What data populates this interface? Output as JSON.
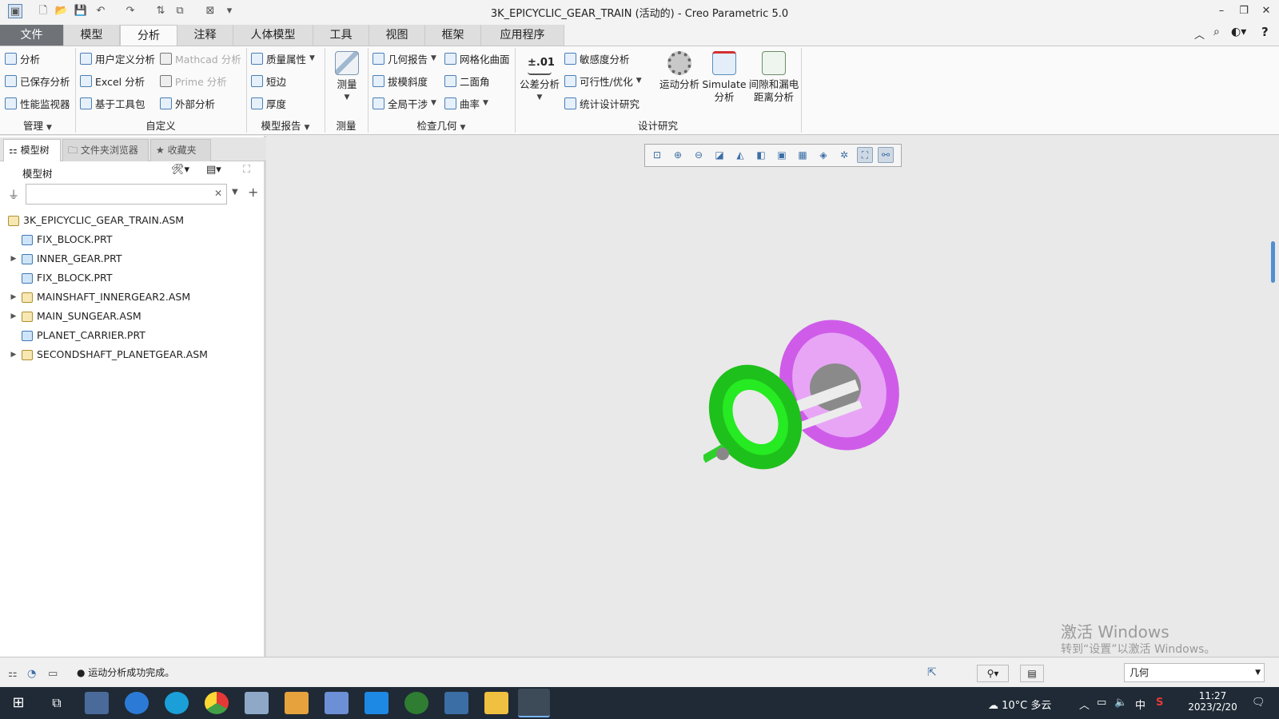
{
  "title": "3K_EPICYCLIC_GEAR_TRAIN (活动的) - Creo Parametric 5.0",
  "tabs": [
    "文件",
    "模型",
    "分析",
    "注释",
    "人体模型",
    "工具",
    "视图",
    "框架",
    "应用程序"
  ],
  "ribbon": {
    "manage": {
      "items": [
        "分析",
        "已保存分析",
        "性能监视器"
      ],
      "group": "管理"
    },
    "custom": {
      "items": [
        "用户定义分析",
        "Excel 分析",
        "基于工具包",
        "Mathcad 分析",
        "Prime 分析",
        "外部分析"
      ],
      "group": "自定义"
    },
    "model_report": {
      "items": [
        "质量属性",
        "短边",
        "厚度"
      ],
      "group": "模型报告"
    },
    "measure": {
      "label": "测量",
      "group": "测量"
    },
    "inspect": {
      "items": [
        "几何报告",
        "拔模斜度",
        "全局干涉",
        "网格化曲面",
        "二面角",
        "曲率"
      ],
      "group": "检查几何"
    },
    "design": {
      "tolerance": "公差分析",
      "tolerance_icon": "±.01",
      "items": [
        "敏感度分析",
        "可行性/优化",
        "统计设计研究"
      ],
      "motion": "运动分析",
      "simulate": [
        "Simulate",
        "分析"
      ],
      "clearance": [
        "间隙和漏电",
        "距离分析"
      ],
      "group": "设计研究"
    }
  },
  "panel": {
    "tabs": [
      "模型树",
      "文件夹浏览器",
      "收藏夹"
    ],
    "header": "模型树",
    "tree": [
      {
        "name": "3K_EPICYCLIC_GEAR_TRAIN.ASM",
        "level": 0,
        "expand": false,
        "type": "asm"
      },
      {
        "name": "FIX_BLOCK.PRT",
        "level": 1,
        "expand": false,
        "type": "prt"
      },
      {
        "name": "INNER_GEAR.PRT",
        "level": 1,
        "expand": true,
        "type": "prt"
      },
      {
        "name": "FIX_BLOCK.PRT",
        "level": 1,
        "expand": false,
        "type": "prt"
      },
      {
        "name": "MAINSHAFT_INNERGEAR2.ASM",
        "level": 1,
        "expand": true,
        "type": "asm"
      },
      {
        "name": "MAIN_SUNGEAR.ASM",
        "level": 1,
        "expand": true,
        "type": "asm"
      },
      {
        "name": "PLANET_CARRIER.PRT",
        "level": 1,
        "expand": false,
        "type": "prt"
      },
      {
        "name": "SECONDSHAFT_PLANETGEAR.ASM",
        "level": 1,
        "expand": true,
        "type": "asm"
      }
    ]
  },
  "status": {
    "message": "运动分析成功完成。",
    "filter": "几何"
  },
  "watermark": {
    "line1": "激活 Windows",
    "line2": "转到“设置”以激活 Windows。"
  },
  "taskbar": {
    "weather": "10°C 多云",
    "ime": "中",
    "time": "11:27",
    "date": "2023/2/20"
  },
  "colors": {
    "green_gear": "#22e81f",
    "magenta_gear": "#d86cf2",
    "file_tab": "#6f7378"
  }
}
